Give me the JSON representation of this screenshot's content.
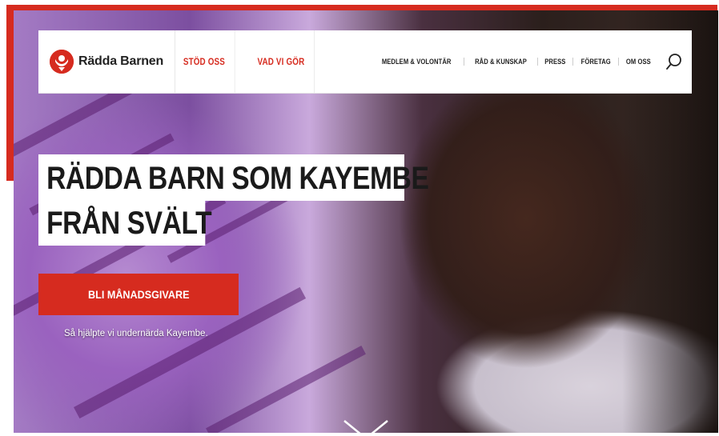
{
  "brand": {
    "name": "Rädda Barnen",
    "color": "#d62b1f"
  },
  "nav": {
    "primary": [
      {
        "label": "STÖD OSS"
      },
      {
        "label": "VAD VI GÖR"
      }
    ],
    "secondary": [
      {
        "label": "MEDLEM & VOLONTÄR"
      },
      {
        "label": "RÅD & KUNSKAP"
      },
      {
        "label": "PRESS"
      },
      {
        "label": "FÖRETAG"
      },
      {
        "label": "OM OSS"
      }
    ],
    "search_icon": "search-icon"
  },
  "hero": {
    "headline_line1": "RÄDDA BARN SOM KAYEMBE",
    "headline_line2": "FRÅN SVÄLT",
    "cta_label": "BLI MÅNADSGIVARE",
    "caption": "Så hjälpte vi undernärda Kayembe.",
    "scroll_icon": "chevron-down-icon"
  }
}
